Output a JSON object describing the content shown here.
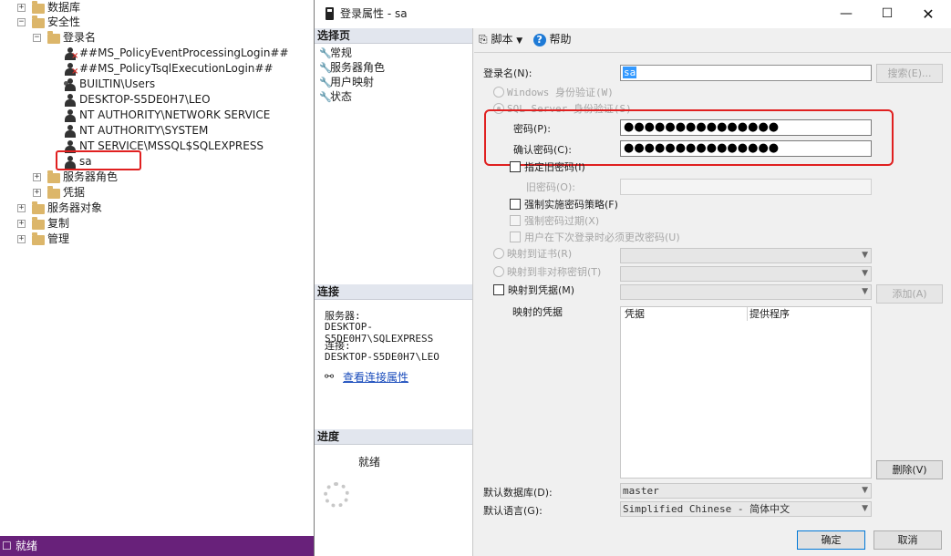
{
  "tree": {
    "databases": "数据库",
    "security": "安全性",
    "logins": "登录名",
    "login_items": [
      "##MS_PolicyEventProcessingLogin##",
      "##MS_PolicyTsqlExecutionLogin##",
      "BUILTIN\\Users",
      "DESKTOP-S5DE0H7\\LEO",
      "NT AUTHORITY\\NETWORK SERVICE",
      "NT AUTHORITY\\SYSTEM",
      "NT SERVICE\\MSSQL$SQLEXPRESS",
      "sa"
    ],
    "server_roles": "服务器角色",
    "credentials": "凭据",
    "server_objects": "服务器对象",
    "replication": "复制",
    "management": "管理"
  },
  "statusbar": {
    "text": "就绪"
  },
  "dialog": {
    "title": "登录属性 - sa",
    "nav_header": "选择页",
    "nav_items": [
      "常规",
      "服务器角色",
      "用户映射",
      "状态"
    ],
    "connection_header": "连接",
    "server_label": "服务器:",
    "server_value": "DESKTOP-S5DE0H7\\SQLEXPRESS",
    "connection_label": "连接:",
    "connection_value": "DESKTOP-S5DE0H7\\LEO",
    "view_connection_props": "查看连接属性",
    "progress_header": "进度",
    "progress_status": "就绪",
    "toolbar": {
      "script": "脚本",
      "help": "帮助"
    },
    "login_name_label": "登录名(N):",
    "login_name_value": "sa",
    "search_button": "搜索(E)...",
    "windows_auth": "Windows 身份验证(W)",
    "sql_auth": "SQL Server 身份验证(S)",
    "password_label": "密码(P):",
    "password_value": "●●●●●●●●●●●●●●●",
    "confirm_password_label": "确认密码(C):",
    "confirm_password_value": "●●●●●●●●●●●●●●●",
    "specify_old_password": "指定旧密码(I)",
    "old_password_label": "旧密码(O):",
    "enforce_policy": "强制实施密码策略(F)",
    "enforce_expiration": "强制密码过期(X)",
    "must_change": "用户在下次登录时必须更改密码(U)",
    "map_certificate": "映射到证书(R)",
    "map_asym_key": "映射到非对称密钥(T)",
    "map_credential": "映射到凭据(M)",
    "add_button": "添加(A)",
    "mapped_credentials_label": "映射的凭据",
    "grid_columns": [
      "凭据",
      "提供程序"
    ],
    "remove_button": "删除(V)",
    "default_db_label": "默认数据库(D):",
    "default_db_value": "master",
    "default_lang_label": "默认语言(G):",
    "default_lang_value": "Simplified Chinese - 简体中文",
    "ok_button": "确定",
    "cancel_button": "取消"
  },
  "colors": {
    "accent": "#0078d7",
    "statusbar": "#68217a",
    "highlight_box": "#e02020",
    "link": "#1a4cbc"
  }
}
